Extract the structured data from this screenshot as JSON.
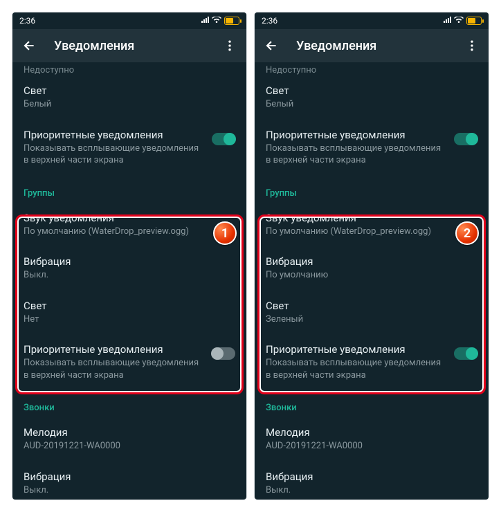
{
  "statusbar": {
    "time": "2:36"
  },
  "appbar": {
    "title": "Уведомления"
  },
  "cutoff_label": "Недоступно",
  "top": {
    "light": {
      "title": "Свет",
      "value": "Белый"
    },
    "priority": {
      "title": "Приоритетные уведомления",
      "desc": "Показывать всплывающие уведомления в верхней части экрана"
    }
  },
  "groups_header": "Группы",
  "left": {
    "sound": {
      "title": "Звук уведомления",
      "value": "По умолчанию (WaterDrop_preview.ogg)"
    },
    "vibration": {
      "title": "Вибрация",
      "value": "Выкл."
    },
    "light": {
      "title": "Свет",
      "value": "Нет"
    },
    "priority": {
      "title": "Приоритетные уведомления",
      "desc": "Показывать всплывающие уведомления в верхней части экрана"
    }
  },
  "right": {
    "sound": {
      "title": "Звук уведомления",
      "value": "По умолчанию (WaterDrop_preview.ogg)"
    },
    "vibration": {
      "title": "Вибрация",
      "value": "По умолчанию"
    },
    "light": {
      "title": "Свет",
      "value": "Зеленый"
    },
    "priority": {
      "title": "Приоритетные уведомления",
      "desc": "Показывать всплывающие уведомления в верхней части экрана"
    }
  },
  "calls_header": "Звонки",
  "calls": {
    "ringtone": {
      "title": "Мелодия",
      "value": "AUD-20191221-WA0000"
    },
    "vibration": {
      "title": "Вибрация",
      "value": "Выкл."
    }
  },
  "badges": {
    "left": "1",
    "right": "2"
  }
}
